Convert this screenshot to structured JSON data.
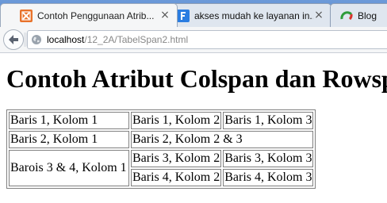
{
  "browser": {
    "tabs": [
      {
        "title": "Contoh Penggunaan Atrib...",
        "close": "×",
        "favicon": "orange-html-icon"
      },
      {
        "title": "akses mudah ke layanan in...",
        "close": "×",
        "favicon": "blue-f-icon"
      },
      {
        "title": "Blog",
        "favicon": "green-loading-icon"
      }
    ],
    "url": {
      "host": "localhost",
      "path": "/12_2A/TabelSpan2.html"
    }
  },
  "page": {
    "heading": "Contoh Atribut Colspan dan Rowspan",
    "table": {
      "r1": [
        "Baris 1, Kolom 1",
        "Baris 1, Kolom 2",
        "Baris 1, Kolom 3"
      ],
      "r2": [
        "Baris 2, Kolom 1",
        "Baris 2, Kolom 2 & 3"
      ],
      "r3": [
        "Barois 3 & 4, Kolom 1",
        "Baris 3, Kolom 2",
        "Baris 3, Kolom 3"
      ],
      "r4": [
        "Baris 4, Kolom 2",
        "Baris 4, Kolom 3"
      ]
    }
  },
  "colors": {
    "tabstrip": "#5b8bd1",
    "orange_favicon": "#e8722a",
    "blue_favicon": "#2b7de1"
  }
}
